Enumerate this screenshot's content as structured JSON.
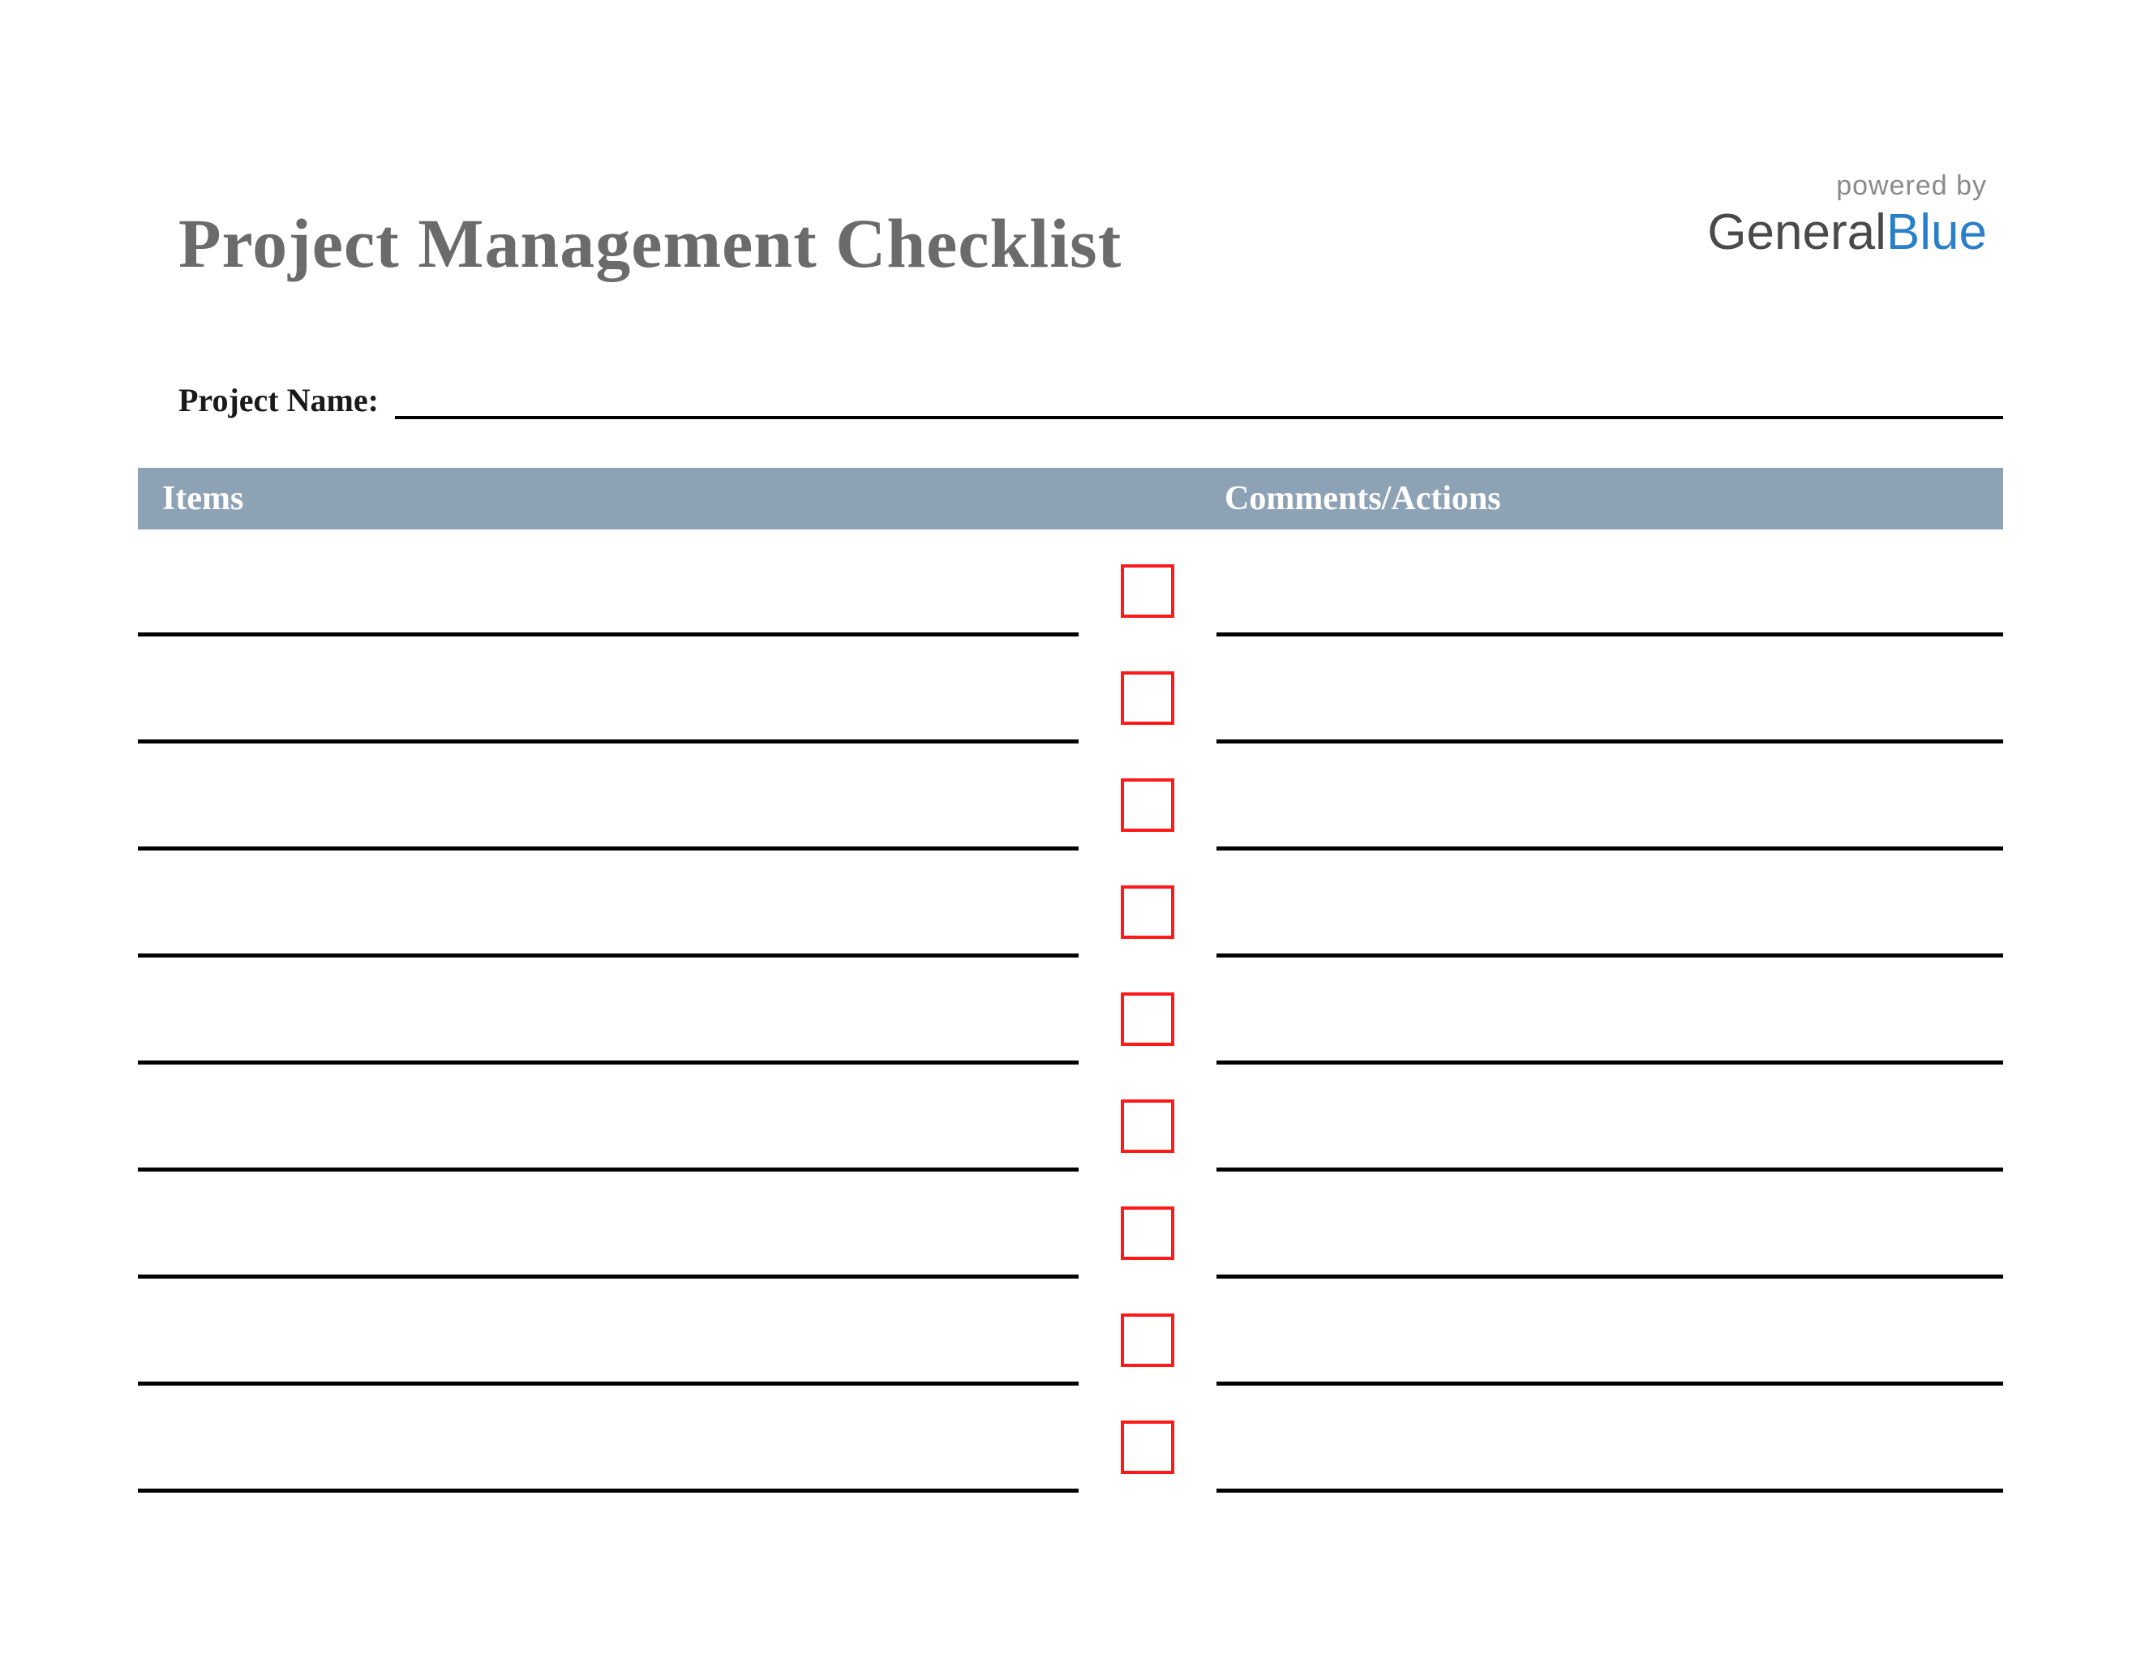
{
  "title": "Project Management Checklist",
  "logo": {
    "powered_by": "powered by",
    "brand_part1": "General",
    "brand_part2": "Blue"
  },
  "project_name_label": "Project Name:",
  "project_name_value": "",
  "columns": {
    "items": "Items",
    "comments": "Comments/Actions"
  },
  "rows": [
    {
      "item": "",
      "checked": false,
      "comment": ""
    },
    {
      "item": "",
      "checked": false,
      "comment": ""
    },
    {
      "item": "",
      "checked": false,
      "comment": ""
    },
    {
      "item": "",
      "checked": false,
      "comment": ""
    },
    {
      "item": "",
      "checked": false,
      "comment": ""
    },
    {
      "item": "",
      "checked": false,
      "comment": ""
    },
    {
      "item": "",
      "checked": false,
      "comment": ""
    },
    {
      "item": "",
      "checked": false,
      "comment": ""
    },
    {
      "item": "",
      "checked": false,
      "comment": ""
    }
  ],
  "colors": {
    "header_bg": "#8da2b5",
    "checkbox_border": "#ff1a1a",
    "title_color": "#6b6b6b",
    "brand_blue": "#2a7fc9"
  }
}
